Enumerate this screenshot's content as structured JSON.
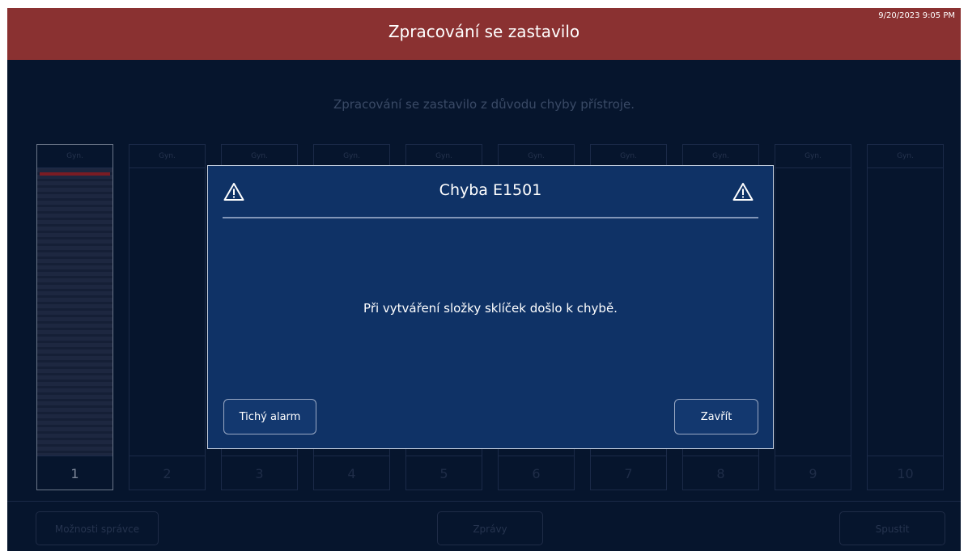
{
  "header": {
    "title": "Zpracování se zastavilo",
    "datetime": "9/20/2023 9:05 PM"
  },
  "subtitle": "Zpracování se zastavilo z důvodu chyby přístroje.",
  "slots": [
    {
      "label": "Gyn.",
      "number": "1"
    },
    {
      "label": "Gyn.",
      "number": "2"
    },
    {
      "label": "Gyn.",
      "number": "3"
    },
    {
      "label": "Gyn.",
      "number": "4"
    },
    {
      "label": "Gyn.",
      "number": "5"
    },
    {
      "label": "Gyn.",
      "number": "6"
    },
    {
      "label": "Gyn.",
      "number": "7"
    },
    {
      "label": "Gyn.",
      "number": "8"
    },
    {
      "label": "Gyn.",
      "number": "9"
    },
    {
      "label": "Gyn.",
      "number": "10"
    }
  ],
  "footer": {
    "options_label": "Možnosti správce",
    "messages_label": "Zprávy",
    "start_label": "Spustit"
  },
  "dialog": {
    "title": "Chyba E1501",
    "icon": "warning-icon",
    "message": "Při vytváření složky sklíček došlo k chybě.",
    "silent_alarm_label": "Tichý alarm",
    "close_label": "Zavřít"
  },
  "colors": {
    "header": "#8a3131",
    "background": "#06152d",
    "dialog": "#0f3266",
    "error_marker": "#7a1c24"
  }
}
